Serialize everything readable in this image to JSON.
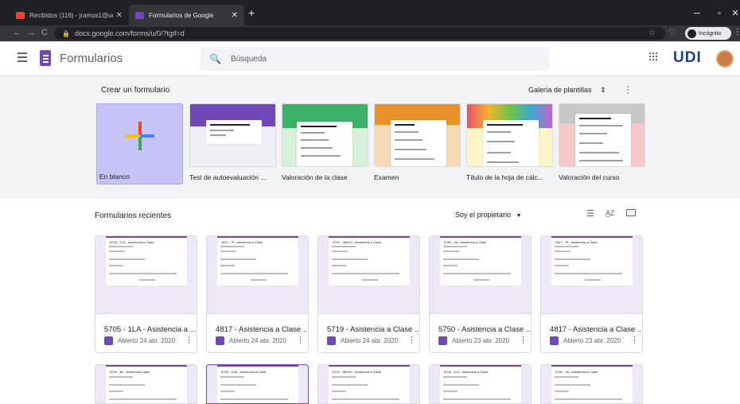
{
  "browser": {
    "tabs": [
      {
        "title": "Recibidos (116) - jramos1@udi.e",
        "active": false
      },
      {
        "title": "Formularios de Google",
        "active": true
      }
    ],
    "url": "docs.google.com/forms/u/0/?tgif=d",
    "incognito_label": "Incógnito"
  },
  "header": {
    "app_name": "Formularios",
    "search_placeholder": "Búsqueda",
    "logo_text": "UDI"
  },
  "gallery": {
    "title": "Crear un formulario",
    "gallery_link": "Galería de plantillas",
    "templates": [
      {
        "label": "En blanco"
      },
      {
        "label": "Test de autoevaluación ..."
      },
      {
        "label": "Valoración de la clase"
      },
      {
        "label": "Examen"
      },
      {
        "label": "Título de la hoja de cálc..."
      },
      {
        "label": "Valoración del curso"
      }
    ]
  },
  "recent": {
    "title": "Formularios recientes",
    "owner_filter": "Soy el propietario",
    "cards": [
      {
        "thumb_title": "5705 - 1LA - Asistencia a Clase",
        "title": "5705 - 1LA - Asistencia a ...",
        "date": "Abierto 24 abr. 2020"
      },
      {
        "thumb_title": "4817 - IP - Asistencia a Clase",
        "title": "4817 - Asistencia a Clase ...",
        "date": "Abierto 24 abr. 2020"
      },
      {
        "thumb_title": "5719 - 5BJKS - Asistencia a Clase",
        "title": "5719 - Asistencia a Clase ...",
        "date": "Abierto 24 abr. 2020"
      },
      {
        "thumb_title": "5750 - 4A - Asistencia a Clase",
        "title": "5750 - Asistencia a Clase ...",
        "date": "Abierto 23 abr. 2020"
      },
      {
        "thumb_title": "4817 - IP - Asistencia a Clase",
        "title": "4817 - Asistencia a Clase ...",
        "date": "Abierto 23 abr. 2020"
      }
    ],
    "cards_row2": [
      {
        "thumb_title": "5705 - BL - Asistencia Clase"
      },
      {
        "thumb_title": "5705 - 4LM - Asistencia a Clase"
      },
      {
        "thumb_title": "5719 - 5BJKS - Asistencia a Clase"
      },
      {
        "thumb_title": "5705 - 1LA - Asistencia a Clase"
      },
      {
        "thumb_title": "5750 - 4A - Asistencia a Clase"
      }
    ]
  },
  "colors": {
    "forms_purple": "#7248b9",
    "blank_bg": "#c6c3f7"
  }
}
